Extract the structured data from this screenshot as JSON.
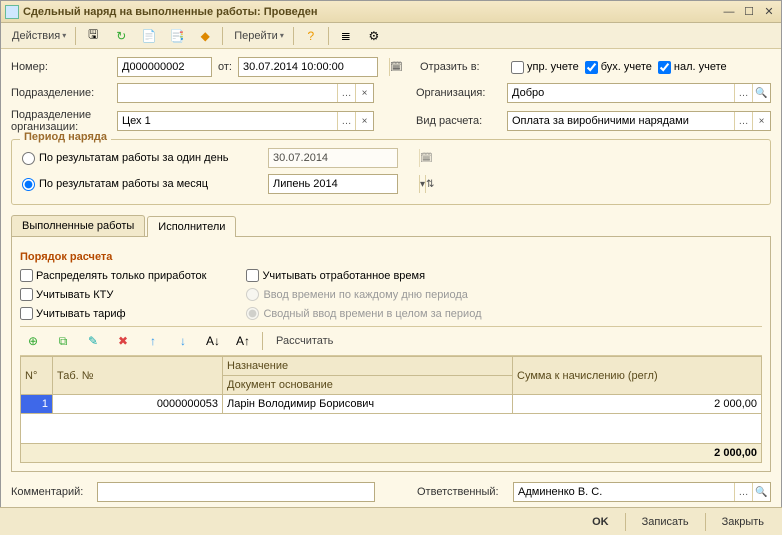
{
  "window": {
    "title": "Сдельный наряд на выполненные работы: Проведен"
  },
  "toolbar": {
    "actions": "Действия",
    "goto": "Перейти"
  },
  "header": {
    "label_number": "Номер:",
    "number": "Д000000002",
    "label_from": "от:",
    "date": "30.07.2014 10:00:00",
    "label_unit": "Подразделение:",
    "unit": "",
    "label_unit_org": "Подразделение организации:",
    "unit_org": "Цех 1",
    "label_reflect": "Отразить в:",
    "chk_mgmt": "упр. учете",
    "chk_acc": "бух. учете",
    "chk_tax": "нал. учете",
    "label_org": "Организация:",
    "org": "Добро",
    "label_calc_type": "Вид расчета:",
    "calc_type": "Оплата за виробничими нарядами"
  },
  "period": {
    "legend": "Период наряда",
    "radio_day": "По результатам работы за один день",
    "radio_month": "По результатам работы за месяц",
    "date": "30.07.2014",
    "month": "Липень 2014"
  },
  "tabs": {
    "tab1": "Выполненные работы",
    "tab2": "Исполнители"
  },
  "calc": {
    "section": "Порядок расчета",
    "chk_surplus": "Распределять только приработок",
    "chk_ktu": "Учитывать КТУ",
    "chk_tariff": "Учитывать тариф",
    "chk_time": "Учитывать отработанное время",
    "radio_daily": "Ввод времени по каждому дню периода",
    "radio_summary": "Сводный ввод времени в целом за период"
  },
  "grid": {
    "calculate": "Рассчитать",
    "col_n": "N°",
    "col_tab": "Таб. №",
    "col_assign": "Назначение",
    "col_basis": "Документ основание",
    "col_sum": "Сумма к начислению (регл)",
    "rows": [
      {
        "n": "1",
        "tab": "0000000053",
        "assign": "Ларін Володимир Борисович",
        "sum": "2 000,00"
      }
    ],
    "total": "2 000,00"
  },
  "footer": {
    "label_comment": "Комментарий:",
    "comment": "",
    "label_responsible": "Ответственный:",
    "responsible": "Админенко В. С."
  },
  "buttons": {
    "ok": "OK",
    "save": "Записать",
    "close": "Закрыть"
  }
}
